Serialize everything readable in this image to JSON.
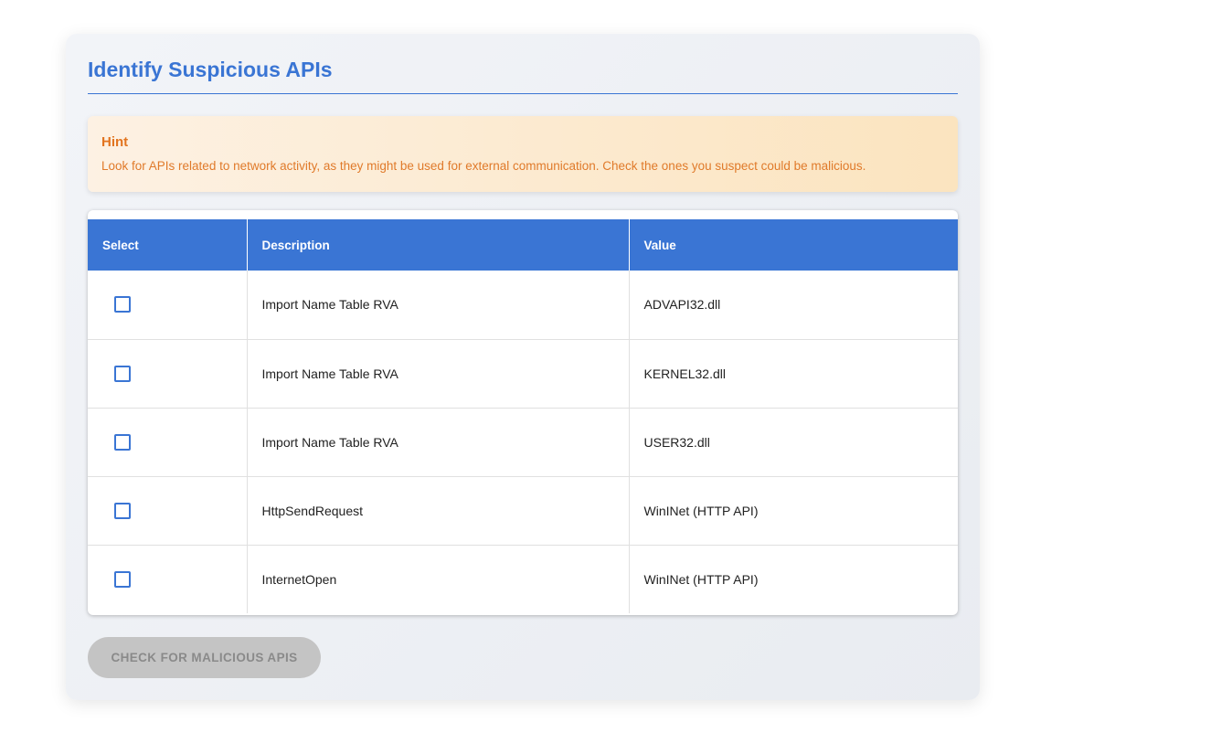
{
  "panel": {
    "title": "Identify Suspicious APIs"
  },
  "hint": {
    "title": "Hint",
    "text": "Look for APIs related to network activity, as they might be used for external communication. Check the ones you suspect could be malicious."
  },
  "table": {
    "headers": {
      "select": "Select",
      "description": "Description",
      "value": "Value"
    },
    "rows": [
      {
        "checked": false,
        "description": "Import Name Table RVA",
        "value": "ADVAPI32.dll"
      },
      {
        "checked": false,
        "description": "Import Name Table RVA",
        "value": "KERNEL32.dll"
      },
      {
        "checked": false,
        "description": "Import Name Table RVA",
        "value": "USER32.dll"
      },
      {
        "checked": false,
        "description": "HttpSendRequest",
        "value": "WinINet (HTTP API)"
      },
      {
        "checked": false,
        "description": "InternetOpen",
        "value": "WinINet (HTTP API)"
      }
    ]
  },
  "actions": {
    "check_label": "CHECK FOR MALICIOUS APIS",
    "check_disabled": true
  },
  "colors": {
    "accent": "#3a75d4",
    "hint_text": "#e07a2a",
    "disabled_button": "#c4c4c4"
  }
}
